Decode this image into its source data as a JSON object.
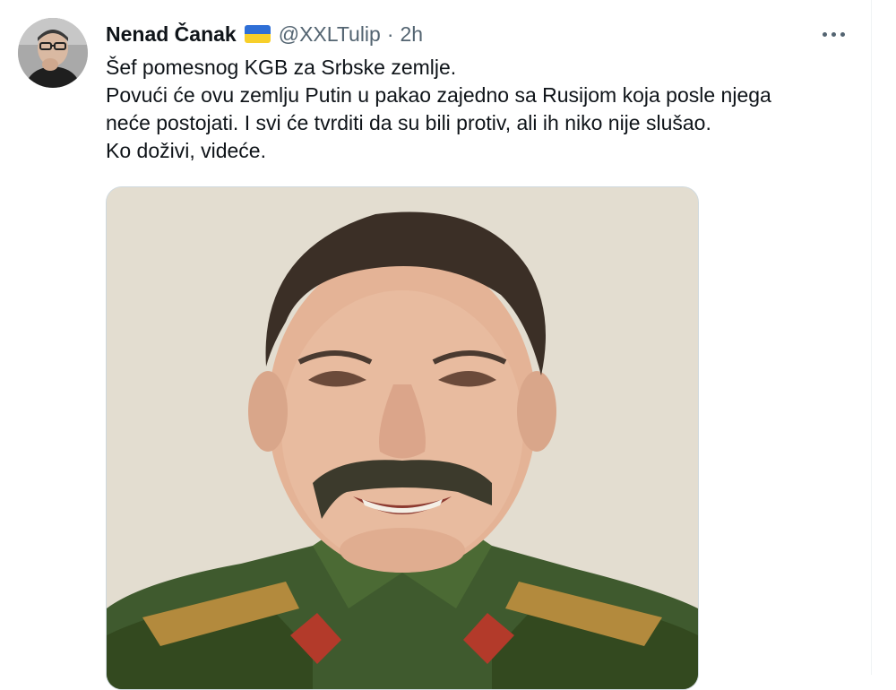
{
  "tweet": {
    "display_name": "Nenad Čanak",
    "verified_flag_icon": "ukraine-flag-icon",
    "handle": "@XXLTulip",
    "separator": "·",
    "time": "2h",
    "more_icon": "more-horizontal-icon",
    "text_lines": [
      "Šef pomesnog KGB za Srbske zemlje.",
      "Povući će ovu zemlju Putin u pakao zajedno sa Rusijom koja posle njega",
      "neće postojati. I svi će tvrditi da su bili protiv, ali ih niko nije slušao.",
      "Ko doživi, videće."
    ]
  },
  "colors": {
    "text_primary": "#0f1419",
    "text_secondary": "#536471",
    "flag_blue": "#2f6fd6",
    "flag_yellow": "#f7cf2a",
    "media_border": "#cfd9de"
  }
}
